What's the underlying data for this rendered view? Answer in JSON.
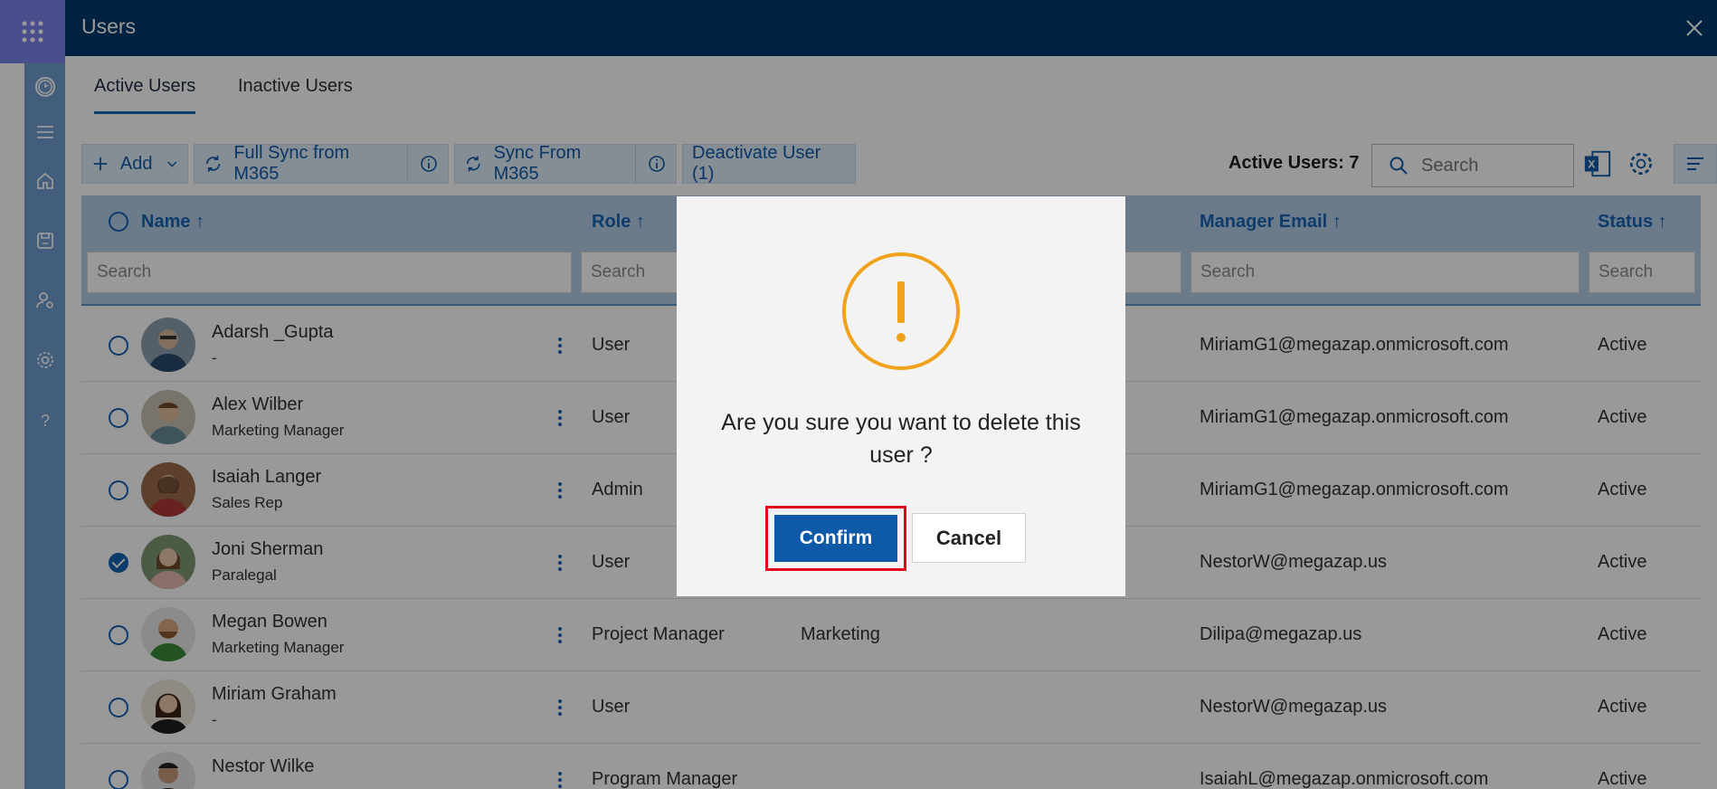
{
  "window": {
    "title": "Users",
    "close_icon": "close-icon"
  },
  "tabs": [
    {
      "label": "Active Users",
      "active": true
    },
    {
      "label": "Inactive Users",
      "active": false
    }
  ],
  "toolbar": {
    "add_label": "Add",
    "full_sync_label": "Full Sync from M365",
    "sync_label": "Sync From M365",
    "deactivate_label": "Deactivate User (1)",
    "active_count": "Active Users: 7",
    "search_placeholder": "Search"
  },
  "columns": {
    "name": "Name ↑",
    "role": "Role ↑",
    "manager_email": "Manager Email ↑",
    "status": "Status ↑"
  },
  "filters": {
    "placeholder": "Search"
  },
  "rows": [
    {
      "name": "Adarsh _Gupta",
      "title": "-",
      "role": "User",
      "department": "",
      "manager_email": "MiriamG1@megazap.onmicrosoft.com",
      "status": "Active",
      "checked": false
    },
    {
      "name": "Alex Wilber",
      "title": "Marketing Manager",
      "role": "User",
      "department": "",
      "manager_email": "MiriamG1@megazap.onmicrosoft.com",
      "status": "Active",
      "checked": false
    },
    {
      "name": "Isaiah Langer",
      "title": "Sales Rep",
      "role": "Admin",
      "department": "",
      "manager_email": "MiriamG1@megazap.onmicrosoft.com",
      "status": "Active",
      "checked": false
    },
    {
      "name": "Joni Sherman",
      "title": "Paralegal",
      "role": "User",
      "department": "",
      "manager_email": "NestorW@megazap.us",
      "status": "Active",
      "checked": true
    },
    {
      "name": "Megan Bowen",
      "title": "Marketing Manager",
      "role": "Project Manager",
      "department": "Marketing",
      "manager_email": "Dilipa@megazap.us",
      "status": "Active",
      "checked": false
    },
    {
      "name": "Miriam Graham",
      "title": "-",
      "role": "User",
      "department": "",
      "manager_email": "NestorW@megazap.us",
      "status": "Active",
      "checked": false
    },
    {
      "name": "Nestor Wilke",
      "title": "",
      "role": "Program Manager",
      "department": "",
      "manager_email": "IsaiahL@megazap.onmicrosoft.com",
      "status": "Active",
      "checked": false
    }
  ],
  "dialog": {
    "icon": "warning-icon",
    "message": "Are you sure you want to delete this user ?",
    "confirm_label": "Confirm",
    "cancel_label": "Cancel"
  },
  "colors": {
    "header": "#003a6c",
    "accent": "#0f5aa8",
    "warning": "#f0a21b",
    "highlight": "#e0061a"
  }
}
